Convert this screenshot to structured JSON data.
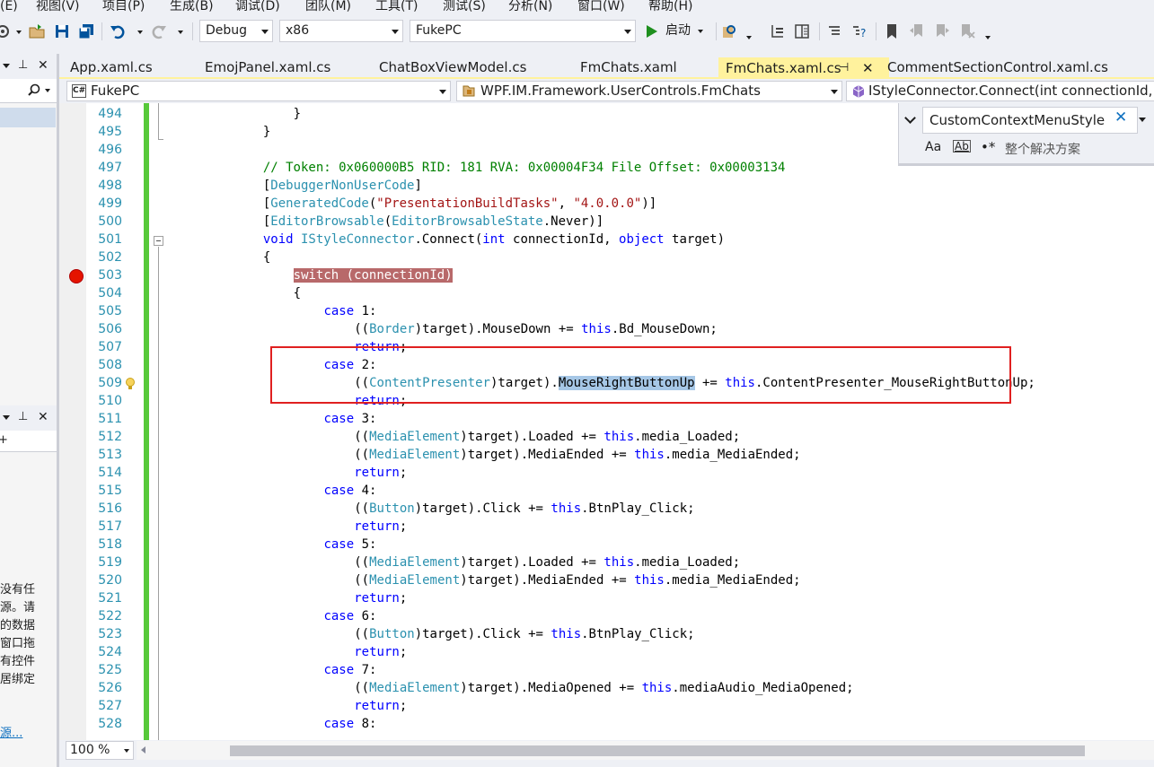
{
  "menu": [
    "(E)",
    "视图(V)",
    "项目(P)",
    "生成(B)",
    "调试(D)",
    "团队(M)",
    "工具(T)",
    "测试(S)",
    "分析(N)",
    "窗口(W)",
    "帮助(H)"
  ],
  "toolbar": {
    "config": "Debug",
    "platform": "x86",
    "startup_project": "FukePC",
    "start_label": "启动",
    "accent_green": "#1e8f1e"
  },
  "tabs": [
    {
      "label": "App.xaml.cs",
      "active": false
    },
    {
      "label": "EmojPanel.xaml.cs",
      "active": false
    },
    {
      "label": "ChatBoxViewModel.cs",
      "active": false
    },
    {
      "label": "FmChats.xaml",
      "active": false
    },
    {
      "label": "FmChats.xaml.cs",
      "active": true
    },
    {
      "label": "CommentSectionControl.xaml.cs",
      "active": false
    }
  ],
  "nav": {
    "project": "FukePC",
    "project_badge": "C#",
    "class": "WPF.IM.Framework.UserControls.FmChats",
    "member": "IStyleConnector.Connect(int connectionId, o"
  },
  "find": {
    "query": "CustomContextMenuStyle",
    "match_case": "Aa",
    "whole_word": "Ab",
    "regex": "•*",
    "scope": "整个解决方案"
  },
  "left_panel": {
    "text_lines": [
      "没有任",
      "源。请",
      "的数据",
      "窗口拖",
      "有控件",
      "居绑定"
    ],
    "link": "源..."
  },
  "zoom": "100 %",
  "editor": {
    "highlight_colors": {
      "breakpoint": "#b8696a",
      "selection": "#a6c7e6",
      "change_bar": "#57c93a"
    },
    "lines": [
      {
        "num": "494",
        "indent": 17,
        "tokens": [
          [
            "pl",
            "}"
          ]
        ]
      },
      {
        "num": "495",
        "indent": 13,
        "tokens": [
          [
            "pl",
            "}"
          ]
        ]
      },
      {
        "num": "496",
        "indent": 0,
        "tokens": []
      },
      {
        "num": "497",
        "indent": 13,
        "tokens": [
          [
            "cm",
            "// Token: 0x060000B5 RID: 181 RVA: 0x00004F34 File Offset: 0x00003134"
          ]
        ]
      },
      {
        "num": "498",
        "indent": 13,
        "tokens": [
          [
            "pl",
            "["
          ],
          [
            "ty",
            "DebuggerNonUserCode"
          ],
          [
            "pl",
            "]"
          ]
        ]
      },
      {
        "num": "499",
        "indent": 13,
        "tokens": [
          [
            "pl",
            "["
          ],
          [
            "ty",
            "GeneratedCode"
          ],
          [
            "pl",
            "("
          ],
          [
            "st",
            "\"PresentationBuildTasks\""
          ],
          [
            "pl",
            ", "
          ],
          [
            "st",
            "\"4.0.0.0\""
          ],
          [
            "pl",
            ")]"
          ]
        ]
      },
      {
        "num": "500",
        "indent": 13,
        "tokens": [
          [
            "pl",
            "["
          ],
          [
            "ty",
            "EditorBrowsable"
          ],
          [
            "pl",
            "("
          ],
          [
            "ty",
            "EditorBrowsableState"
          ],
          [
            "pl",
            ".Never)]"
          ]
        ]
      },
      {
        "num": "501",
        "indent": 13,
        "tokens": [
          [
            "kw",
            "void"
          ],
          [
            "pl",
            " "
          ],
          [
            "ty",
            "IStyleConnector"
          ],
          [
            "pl",
            ".Connect("
          ],
          [
            "kw",
            "int"
          ],
          [
            "pl",
            " connectionId, "
          ],
          [
            "kw",
            "object"
          ],
          [
            "pl",
            " target)"
          ]
        ]
      },
      {
        "num": "502",
        "indent": 13,
        "tokens": [
          [
            "pl",
            "{"
          ]
        ]
      },
      {
        "num": "503",
        "indent": 17,
        "tokens": [
          [
            "hl-bp",
            "switch (connectionId)"
          ]
        ]
      },
      {
        "num": "504",
        "indent": 17,
        "tokens": [
          [
            "pl",
            "{"
          ]
        ]
      },
      {
        "num": "505",
        "indent": 21,
        "tokens": [
          [
            "kw",
            "case"
          ],
          [
            "pl",
            " 1:"
          ]
        ]
      },
      {
        "num": "506",
        "indent": 25,
        "tokens": [
          [
            "pl",
            "(("
          ],
          [
            "ty",
            "Border"
          ],
          [
            "pl",
            ")target).MouseDown += "
          ],
          [
            "kw",
            "this"
          ],
          [
            "pl",
            ".Bd_MouseDown;"
          ]
        ]
      },
      {
        "num": "507",
        "indent": 25,
        "tokens": [
          [
            "kw",
            "return"
          ],
          [
            "pl",
            ";"
          ]
        ]
      },
      {
        "num": "508",
        "indent": 21,
        "tokens": [
          [
            "kw",
            "case"
          ],
          [
            "pl",
            " 2:"
          ]
        ]
      },
      {
        "num": "509",
        "indent": 25,
        "tokens": [
          [
            "pl",
            "(("
          ],
          [
            "ty",
            "ContentPresenter"
          ],
          [
            "pl",
            ")target)."
          ],
          [
            "hl-sel",
            "MouseRightButtonUp"
          ],
          [
            "pl",
            " += "
          ],
          [
            "kw",
            "this"
          ],
          [
            "pl",
            ".ContentPresenter_MouseRightButtonUp;"
          ]
        ]
      },
      {
        "num": "510",
        "indent": 25,
        "tokens": [
          [
            "kw",
            "return"
          ],
          [
            "pl",
            ";"
          ]
        ]
      },
      {
        "num": "511",
        "indent": 21,
        "tokens": [
          [
            "kw",
            "case"
          ],
          [
            "pl",
            " 3:"
          ]
        ]
      },
      {
        "num": "512",
        "indent": 25,
        "tokens": [
          [
            "pl",
            "(("
          ],
          [
            "ty",
            "MediaElement"
          ],
          [
            "pl",
            ")target).Loaded += "
          ],
          [
            "kw",
            "this"
          ],
          [
            "pl",
            ".media_Loaded;"
          ]
        ]
      },
      {
        "num": "513",
        "indent": 25,
        "tokens": [
          [
            "pl",
            "(("
          ],
          [
            "ty",
            "MediaElement"
          ],
          [
            "pl",
            ")target).MediaEnded += "
          ],
          [
            "kw",
            "this"
          ],
          [
            "pl",
            ".media_MediaEnded;"
          ]
        ]
      },
      {
        "num": "514",
        "indent": 25,
        "tokens": [
          [
            "kw",
            "return"
          ],
          [
            "pl",
            ";"
          ]
        ]
      },
      {
        "num": "515",
        "indent": 21,
        "tokens": [
          [
            "kw",
            "case"
          ],
          [
            "pl",
            " 4:"
          ]
        ]
      },
      {
        "num": "516",
        "indent": 25,
        "tokens": [
          [
            "pl",
            "(("
          ],
          [
            "ty",
            "Button"
          ],
          [
            "pl",
            ")target).Click += "
          ],
          [
            "kw",
            "this"
          ],
          [
            "pl",
            ".BtnPlay_Click;"
          ]
        ]
      },
      {
        "num": "517",
        "indent": 25,
        "tokens": [
          [
            "kw",
            "return"
          ],
          [
            "pl",
            ";"
          ]
        ]
      },
      {
        "num": "518",
        "indent": 21,
        "tokens": [
          [
            "kw",
            "case"
          ],
          [
            "pl",
            " 5:"
          ]
        ]
      },
      {
        "num": "519",
        "indent": 25,
        "tokens": [
          [
            "pl",
            "(("
          ],
          [
            "ty",
            "MediaElement"
          ],
          [
            "pl",
            ")target).Loaded += "
          ],
          [
            "kw",
            "this"
          ],
          [
            "pl",
            ".media_Loaded;"
          ]
        ]
      },
      {
        "num": "520",
        "indent": 25,
        "tokens": [
          [
            "pl",
            "(("
          ],
          [
            "ty",
            "MediaElement"
          ],
          [
            "pl",
            ")target).MediaEnded += "
          ],
          [
            "kw",
            "this"
          ],
          [
            "pl",
            ".media_MediaEnded;"
          ]
        ]
      },
      {
        "num": "521",
        "indent": 25,
        "tokens": [
          [
            "kw",
            "return"
          ],
          [
            "pl",
            ";"
          ]
        ]
      },
      {
        "num": "522",
        "indent": 21,
        "tokens": [
          [
            "kw",
            "case"
          ],
          [
            "pl",
            " 6:"
          ]
        ]
      },
      {
        "num": "523",
        "indent": 25,
        "tokens": [
          [
            "pl",
            "(("
          ],
          [
            "ty",
            "Button"
          ],
          [
            "pl",
            ")target).Click += "
          ],
          [
            "kw",
            "this"
          ],
          [
            "pl",
            ".BtnPlay_Click;"
          ]
        ]
      },
      {
        "num": "524",
        "indent": 25,
        "tokens": [
          [
            "kw",
            "return"
          ],
          [
            "pl",
            ";"
          ]
        ]
      },
      {
        "num": "525",
        "indent": 21,
        "tokens": [
          [
            "kw",
            "case"
          ],
          [
            "pl",
            " 7:"
          ]
        ]
      },
      {
        "num": "526",
        "indent": 25,
        "tokens": [
          [
            "pl",
            "(("
          ],
          [
            "ty",
            "MediaElement"
          ],
          [
            "pl",
            ")target).MediaOpened += "
          ],
          [
            "kw",
            "this"
          ],
          [
            "pl",
            ".mediaAudio_MediaOpened;"
          ]
        ]
      },
      {
        "num": "527",
        "indent": 25,
        "tokens": [
          [
            "kw",
            "return"
          ],
          [
            "pl",
            ";"
          ]
        ]
      },
      {
        "num": "528",
        "indent": 21,
        "tokens": [
          [
            "kw",
            "case"
          ],
          [
            "pl",
            " 8:"
          ]
        ]
      }
    ]
  }
}
